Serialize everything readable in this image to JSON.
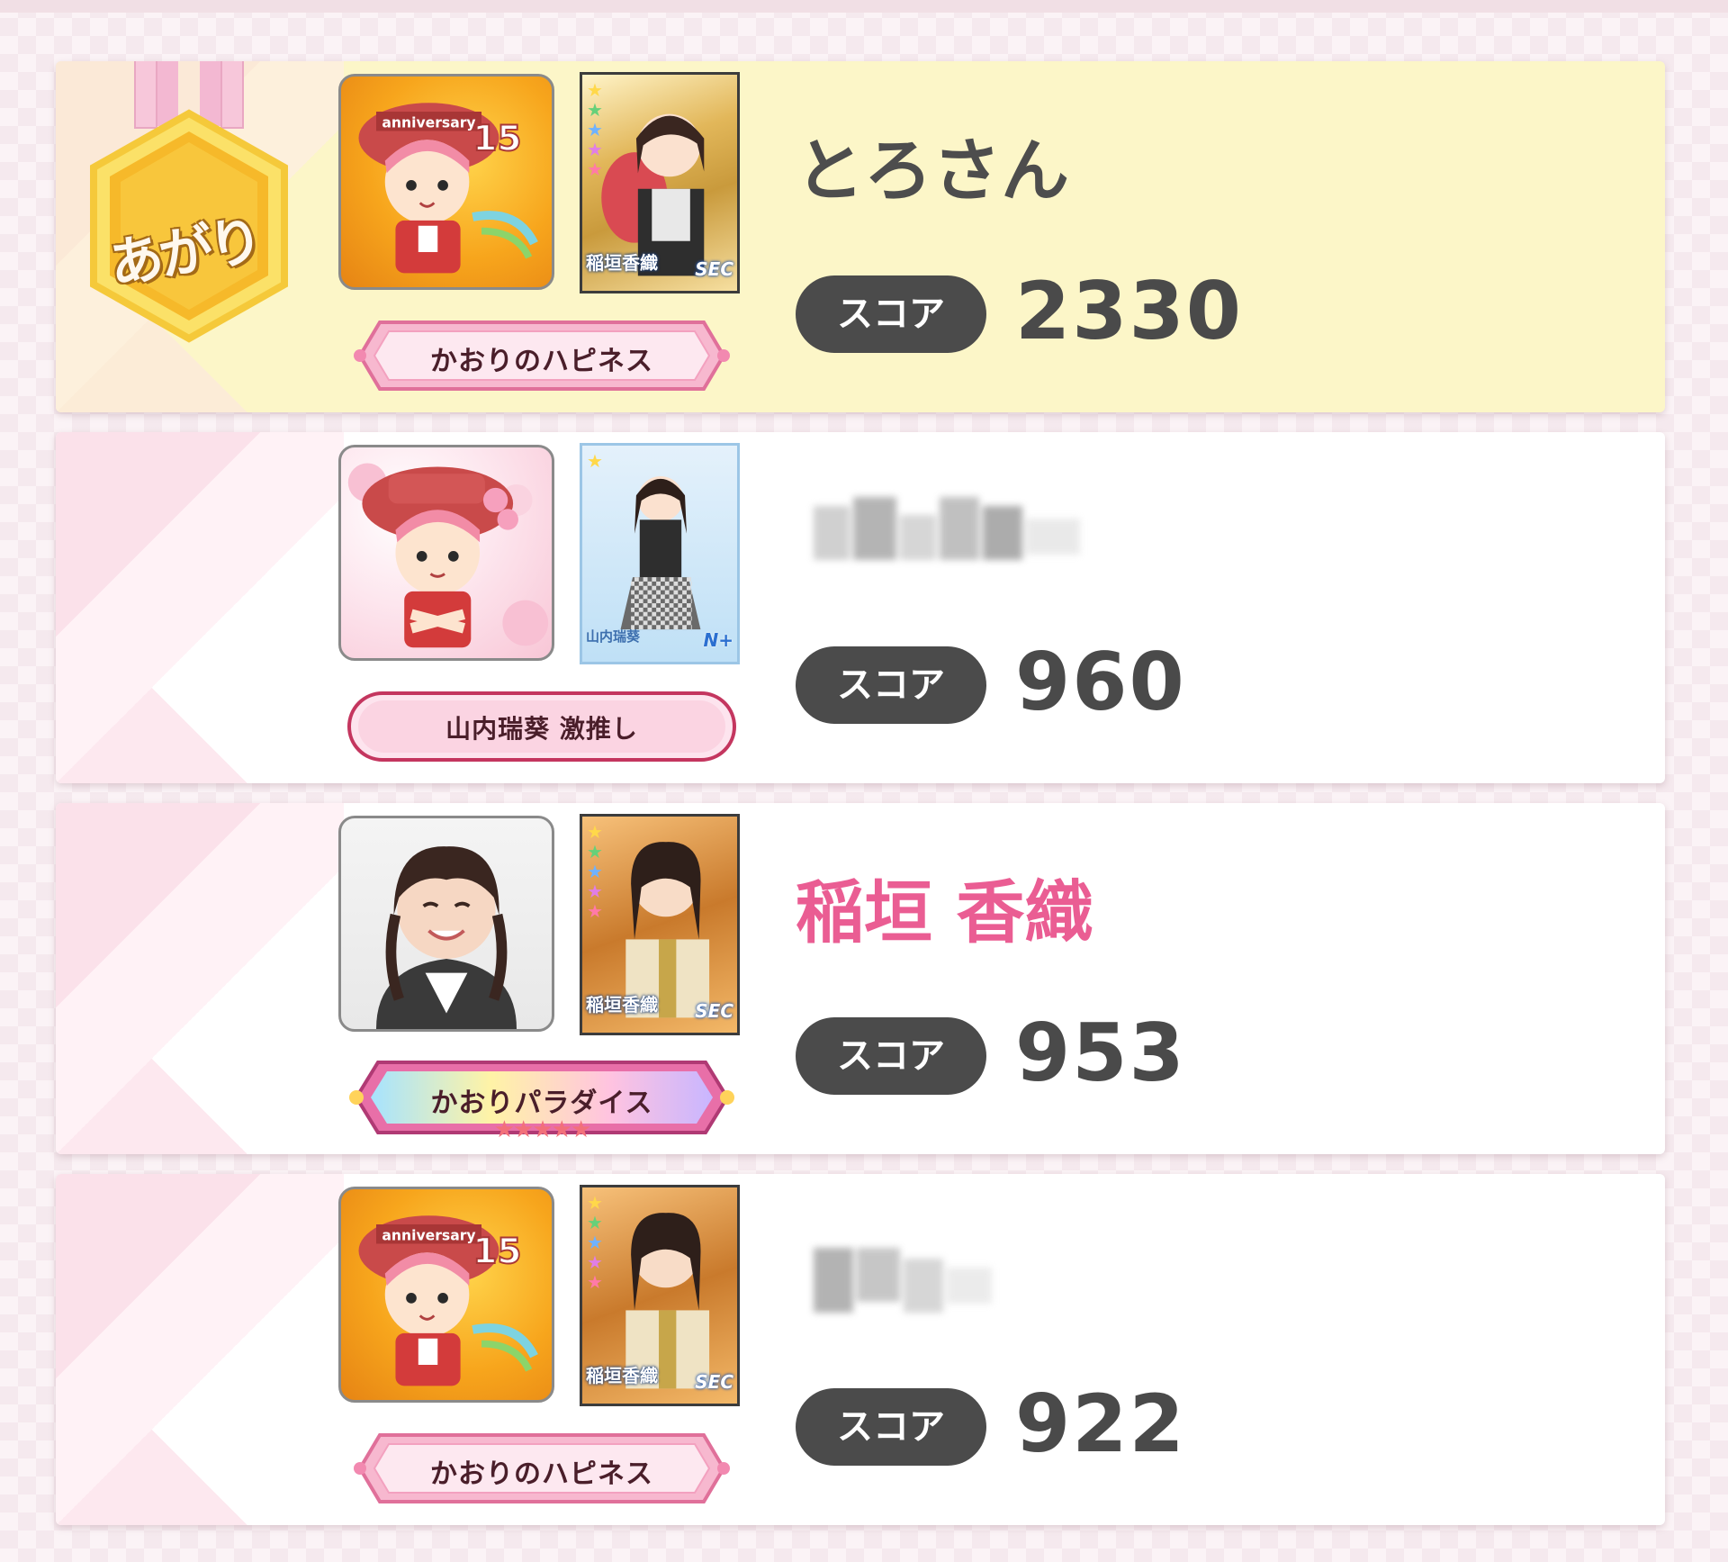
{
  "score_label": "スコア",
  "medal": {
    "label": "あがり",
    "icon": "gold-medal-icon"
  },
  "entries": [
    {
      "name": "とろさん",
      "name_hidden": false,
      "score": "2330",
      "title": "かおりのハピネス",
      "avatar": "anniversary-15-chibi-avatar",
      "card": {
        "name": "稲垣香織",
        "rarity": "SEC"
      },
      "highlight": true
    },
    {
      "name": "",
      "name_hidden": true,
      "score": "960",
      "title": "山内瑞葵 激推し",
      "avatar": "sakura-chibi-avatar",
      "card": {
        "name": "山内瑞葵",
        "rarity": "N+"
      },
      "highlight": false
    },
    {
      "name": "稲垣 香織",
      "name_hidden": false,
      "score": "953",
      "title": "かおりパラダイス",
      "avatar": "member-photo-avatar",
      "card": {
        "name": "稲垣香織",
        "rarity": "SEC"
      },
      "highlight": false
    },
    {
      "name": "",
      "name_hidden": true,
      "score": "922",
      "title": "かおりのハピネス",
      "avatar": "anniversary-15-chibi-avatar",
      "card": {
        "name": "稲垣香織",
        "rarity": "SEC"
      },
      "highlight": false
    }
  ],
  "colors": {
    "highlight_row": "#fcf6c8",
    "member_name": "#ea5d93",
    "score_pill": "#4b4b4b",
    "plate_pink": "#f7b8cf"
  }
}
